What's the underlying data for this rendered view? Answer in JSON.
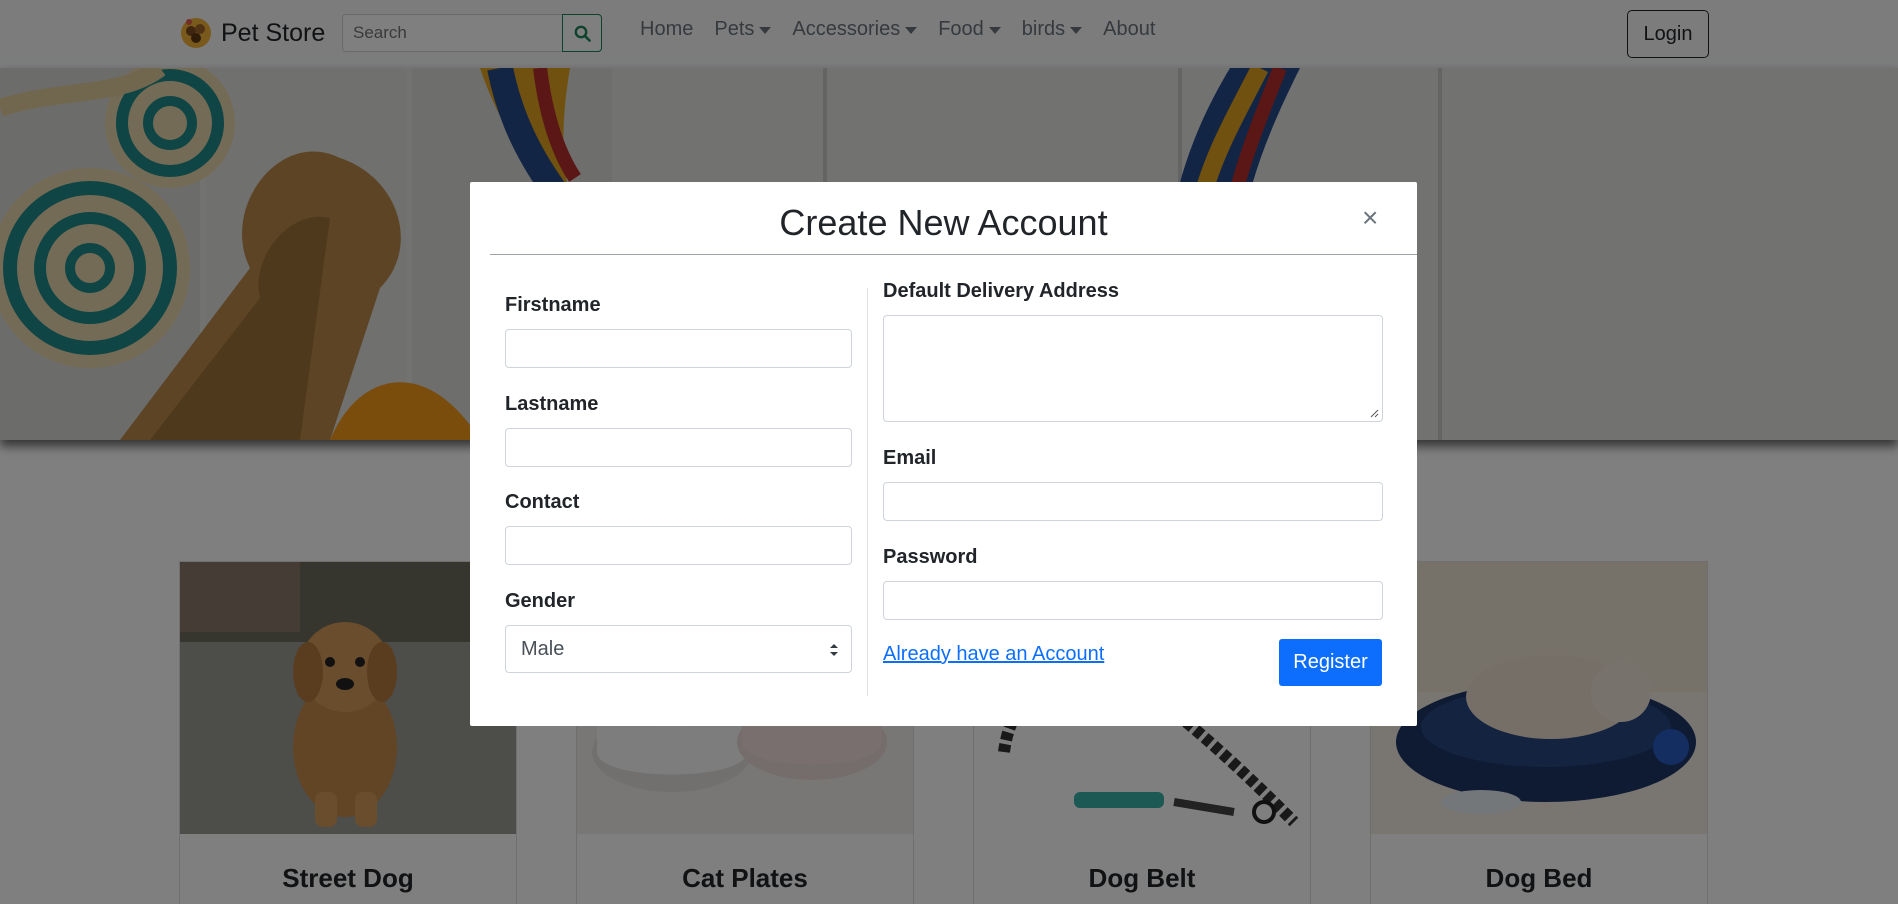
{
  "navbar": {
    "brand": "Pet Store",
    "search_placeholder": "Search",
    "links": [
      {
        "label": "Home"
      },
      {
        "label": "Pets"
      },
      {
        "label": "Accessories"
      },
      {
        "label": "Food"
      },
      {
        "label": "birds"
      },
      {
        "label": "About"
      }
    ],
    "login_label": "Login"
  },
  "cards": [
    {
      "title": "Street Dog"
    },
    {
      "title": "Cat Plates"
    },
    {
      "title": "Dog Belt"
    },
    {
      "title": "Dog Bed"
    }
  ],
  "modal": {
    "title": "Create New Account",
    "close": "×",
    "firstname_label": "Firstname",
    "lastname_label": "Lastname",
    "contact_label": "Contact",
    "gender_label": "Gender",
    "gender_value": "Male",
    "address_label": "Default Delivery Address",
    "email_label": "Email",
    "password_label": "Password",
    "login_link": "Already have an Account",
    "register_label": "Register"
  },
  "colors": {
    "primary": "#0d6efd",
    "search_button": "#198754"
  }
}
